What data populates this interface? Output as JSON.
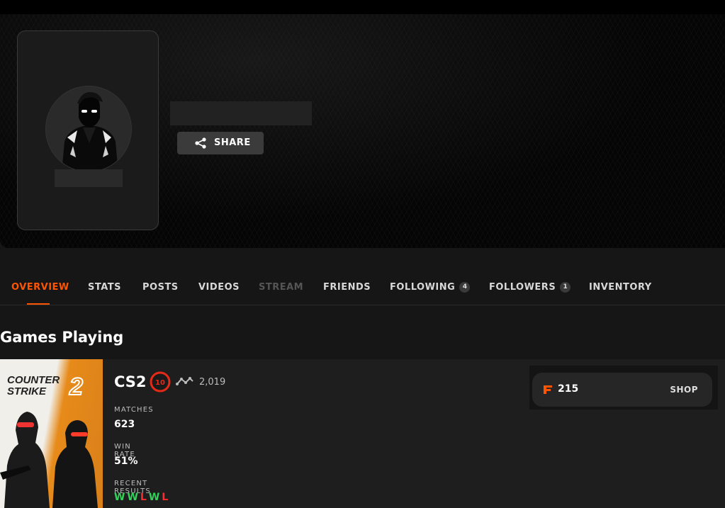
{
  "profile": {
    "share_label": "SHARE"
  },
  "tabs": [
    {
      "label": "OVERVIEW",
      "state": "active"
    },
    {
      "label": "STATS",
      "state": "normal"
    },
    {
      "label": "POSTS",
      "state": "normal"
    },
    {
      "label": "VIDEOS",
      "state": "normal"
    },
    {
      "label": "STREAM",
      "state": "disabled"
    },
    {
      "label": "FRIENDS",
      "state": "normal"
    },
    {
      "label": "FOLLOWING",
      "state": "normal",
      "badge": "4"
    },
    {
      "label": "FOLLOWERS",
      "state": "normal",
      "badge": "1"
    },
    {
      "label": "INVENTORY",
      "state": "normal"
    }
  ],
  "games_section": {
    "title": "Games Playing",
    "game": {
      "cover_title_line1": "COUNTER",
      "cover_title_line2": "STRIKE",
      "cover_title_number": "2",
      "name": "CS2",
      "level": "10",
      "elo": "2,019",
      "matches_label": "MATCHES",
      "matches_value": "623",
      "win_rate_label": "WIN RATE",
      "win_rate_value": "51%",
      "recent_results_label": "RECENT RESULTS",
      "recent_results": [
        "W",
        "W",
        "L",
        "W",
        "L"
      ]
    }
  },
  "shop": {
    "points": "215",
    "label": "SHOP"
  },
  "colors": {
    "accent": "#ff5500",
    "win": "#32d35a",
    "loss": "#ff2a2a",
    "level_ring": "#e52a17"
  },
  "icons": {
    "share": "share-icon",
    "level": "skill-level-10-icon",
    "elo": "elo-graph-icon",
    "points": "faceit-points-icon"
  }
}
